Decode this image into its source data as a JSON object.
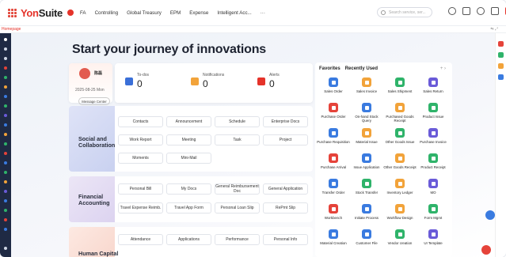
{
  "brand": {
    "name_red": "Yon",
    "name_dark": "Suite"
  },
  "nav": {
    "items": [
      "FA",
      "Controlling",
      "Global Treasury",
      "EPM",
      "Expense",
      "Intelligent Acc...",
      "···"
    ]
  },
  "search": {
    "placeholder": "Search service, ser..."
  },
  "tabs": {
    "home": "Homepage"
  },
  "page": {
    "title": "Start your journey of innovations"
  },
  "user": {
    "name": "陈磊",
    "date": "2025-08-25 Mon",
    "message_center": "Message Center"
  },
  "stats": [
    {
      "label": "To-dos",
      "count": "0",
      "color": "#3a6fd8"
    },
    {
      "label": "Notifications",
      "count": "0",
      "color": "#f2a33a"
    },
    {
      "label": "Alerts",
      "count": "0",
      "color": "#e5332a"
    }
  ],
  "sections": {
    "social": {
      "name": "Social and\nCollaboration",
      "items": [
        "Contacts",
        "Announcement",
        "Schedule",
        "Enterprise Docs",
        "Work Report",
        "Meeting",
        "Task",
        "Project",
        "Moments",
        "Mini-Mail"
      ]
    },
    "financial": {
      "name": "Financial\nAccounting",
      "items": [
        "Personal Bill",
        "My Docs",
        "General\nReimbursement Doc",
        "General Application",
        "Travel Expense Reimb.",
        "Travel App Form",
        "Personal Loan Slip",
        "RePmt Slip"
      ]
    },
    "hr": {
      "name": "Human Capital",
      "items": [
        "Attendance",
        "Applications",
        "Performance",
        "Personal Info"
      ]
    }
  },
  "favorites": {
    "tabs": [
      "Favorites",
      "Recently Used"
    ],
    "controls": "+ ›",
    "apps": [
      {
        "label": "Sales Order",
        "color": "#3a7be0"
      },
      {
        "label": "Sales Invoice",
        "color": "#f2a33a"
      },
      {
        "label": "Sales Shipment",
        "color": "#2fb36a"
      },
      {
        "label": "Sales Return",
        "color": "#6a5bd8"
      },
      {
        "label": "Purchase Order",
        "color": "#e5433a"
      },
      {
        "label": "On-hand Stock Query",
        "color": "#3a7be0"
      },
      {
        "label": "Purchased Goods Receipt",
        "color": "#f2a33a"
      },
      {
        "label": "Product Issue",
        "color": "#2fb36a"
      },
      {
        "label": "Purchase Requisition",
        "color": "#3a7be0"
      },
      {
        "label": "Material Issue",
        "color": "#f2a33a"
      },
      {
        "label": "Other Goods Issue",
        "color": "#2fb36a"
      },
      {
        "label": "Purchase Invoice",
        "color": "#6a5bd8"
      },
      {
        "label": "Purchase Arrival",
        "color": "#e5433a"
      },
      {
        "label": "Issue Application",
        "color": "#3a7be0"
      },
      {
        "label": "Other Goods Receipt",
        "color": "#f2a33a"
      },
      {
        "label": "Product Receipt",
        "color": "#2fb36a"
      },
      {
        "label": "Transfer Order",
        "color": "#3a7be0"
      },
      {
        "label": "Stock Transfer",
        "color": "#2fb36a"
      },
      {
        "label": "Inventory Ledger",
        "color": "#f2a33a"
      },
      {
        "label": "MO",
        "color": "#6a5bd8"
      },
      {
        "label": "Workbench",
        "color": "#e5433a"
      },
      {
        "label": "Initiate Process",
        "color": "#3a7be0"
      },
      {
        "label": "Workflow Design",
        "color": "#f2a33a"
      },
      {
        "label": "Form Mgmt",
        "color": "#2fb36a"
      },
      {
        "label": "Material Creation",
        "color": "#3a7be0"
      },
      {
        "label": "Customer File",
        "color": "#3a7be0"
      },
      {
        "label": "Vendor creation",
        "color": "#2fb36a"
      },
      {
        "label": "UI Template",
        "color": "#6a5bd8"
      }
    ]
  }
}
